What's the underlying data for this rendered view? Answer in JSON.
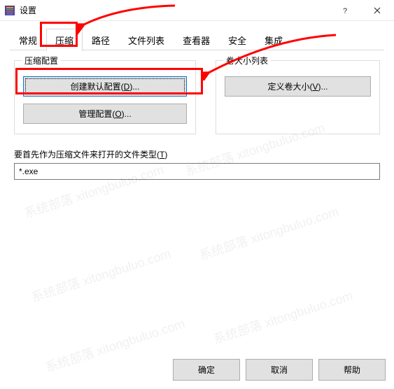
{
  "window": {
    "title": "设置"
  },
  "tabs": {
    "general": "常规",
    "compress": "压缩",
    "path": "路径",
    "filelist": "文件列表",
    "viewer": "查看器",
    "security": "安全",
    "integration": "集成"
  },
  "groups": {
    "compressProfile": {
      "legend": "压缩配置",
      "createDefault_pre": "创建默认配置(",
      "createDefault_key": "D",
      "createDefault_post": ")...",
      "manage_pre": "管理配置(",
      "manage_key": "O",
      "manage_post": ")..."
    },
    "volumes": {
      "legend": "卷大小列表",
      "define_pre": "定义卷大小(",
      "define_key": "V",
      "define_post": ")..."
    }
  },
  "filetype": {
    "label_pre": "要首先作为压缩文件来打开的文件类型(",
    "label_key": "T",
    "label_post": ")",
    "value": "*.exe"
  },
  "footer": {
    "ok": "确定",
    "cancel": "取消",
    "help": "帮助"
  },
  "watermark": "系统部落 xitongbuluo.com"
}
